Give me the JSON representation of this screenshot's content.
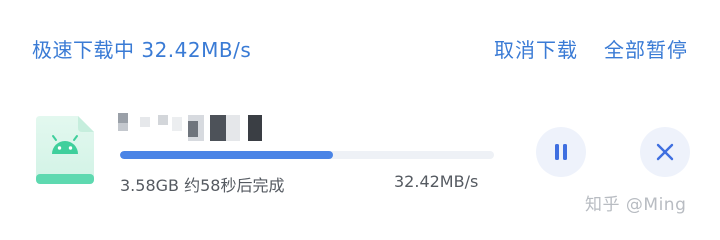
{
  "header": {
    "status_text": "极速下载中 32.42MB/s",
    "cancel_label": "取消下载",
    "pause_all_label": "全部暂停"
  },
  "download_item": {
    "icon": "android-icon",
    "file_name_visible": false,
    "progress_fraction": 0.57,
    "size_eta_text": "3.58GB 约58秒后完成",
    "speed_text": "32.42MB/s",
    "pause_icon": "pause-icon",
    "close_icon": "close-icon"
  },
  "colors": {
    "accent": "#3a7bd5",
    "progress_fill": "#4a84e6",
    "progress_track": "#eef1f6",
    "icon_green": "#3fcf9c",
    "button_bg": "#eef2fb"
  },
  "watermark": {
    "text": "知乎 @Ming"
  }
}
